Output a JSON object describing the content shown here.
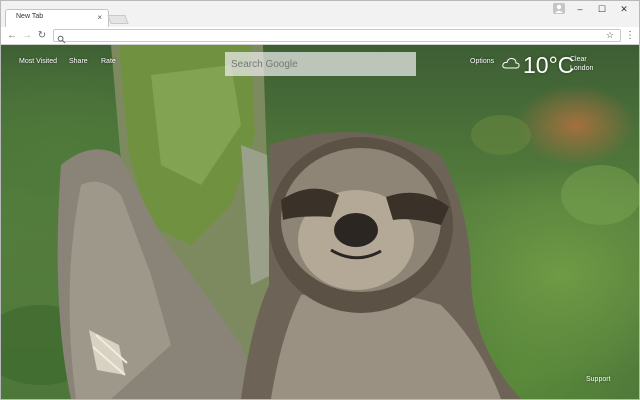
{
  "window": {
    "tab_title": "New Tab",
    "tab_close": "×",
    "controls": {
      "minimize": "–",
      "maximize": "☐",
      "close": "✕"
    }
  },
  "toolbar": {
    "back": "←",
    "forward": "→",
    "reload": "↻",
    "address_value": "",
    "bookmark_star": "☆",
    "menu": "⋮"
  },
  "newtab": {
    "links": [
      "Most Visited",
      "Share",
      "Rate"
    ],
    "search_placeholder": "Search Google",
    "options": "Options",
    "weather": {
      "temperature": "10°C",
      "condition": "Clear",
      "location": "London",
      "icon": "cloud-icon"
    },
    "support": "Support"
  },
  "colors": {
    "chrome_bg": "#f2f2f2",
    "foliage_green": "#567f3d",
    "text_white": "#ffffff"
  }
}
